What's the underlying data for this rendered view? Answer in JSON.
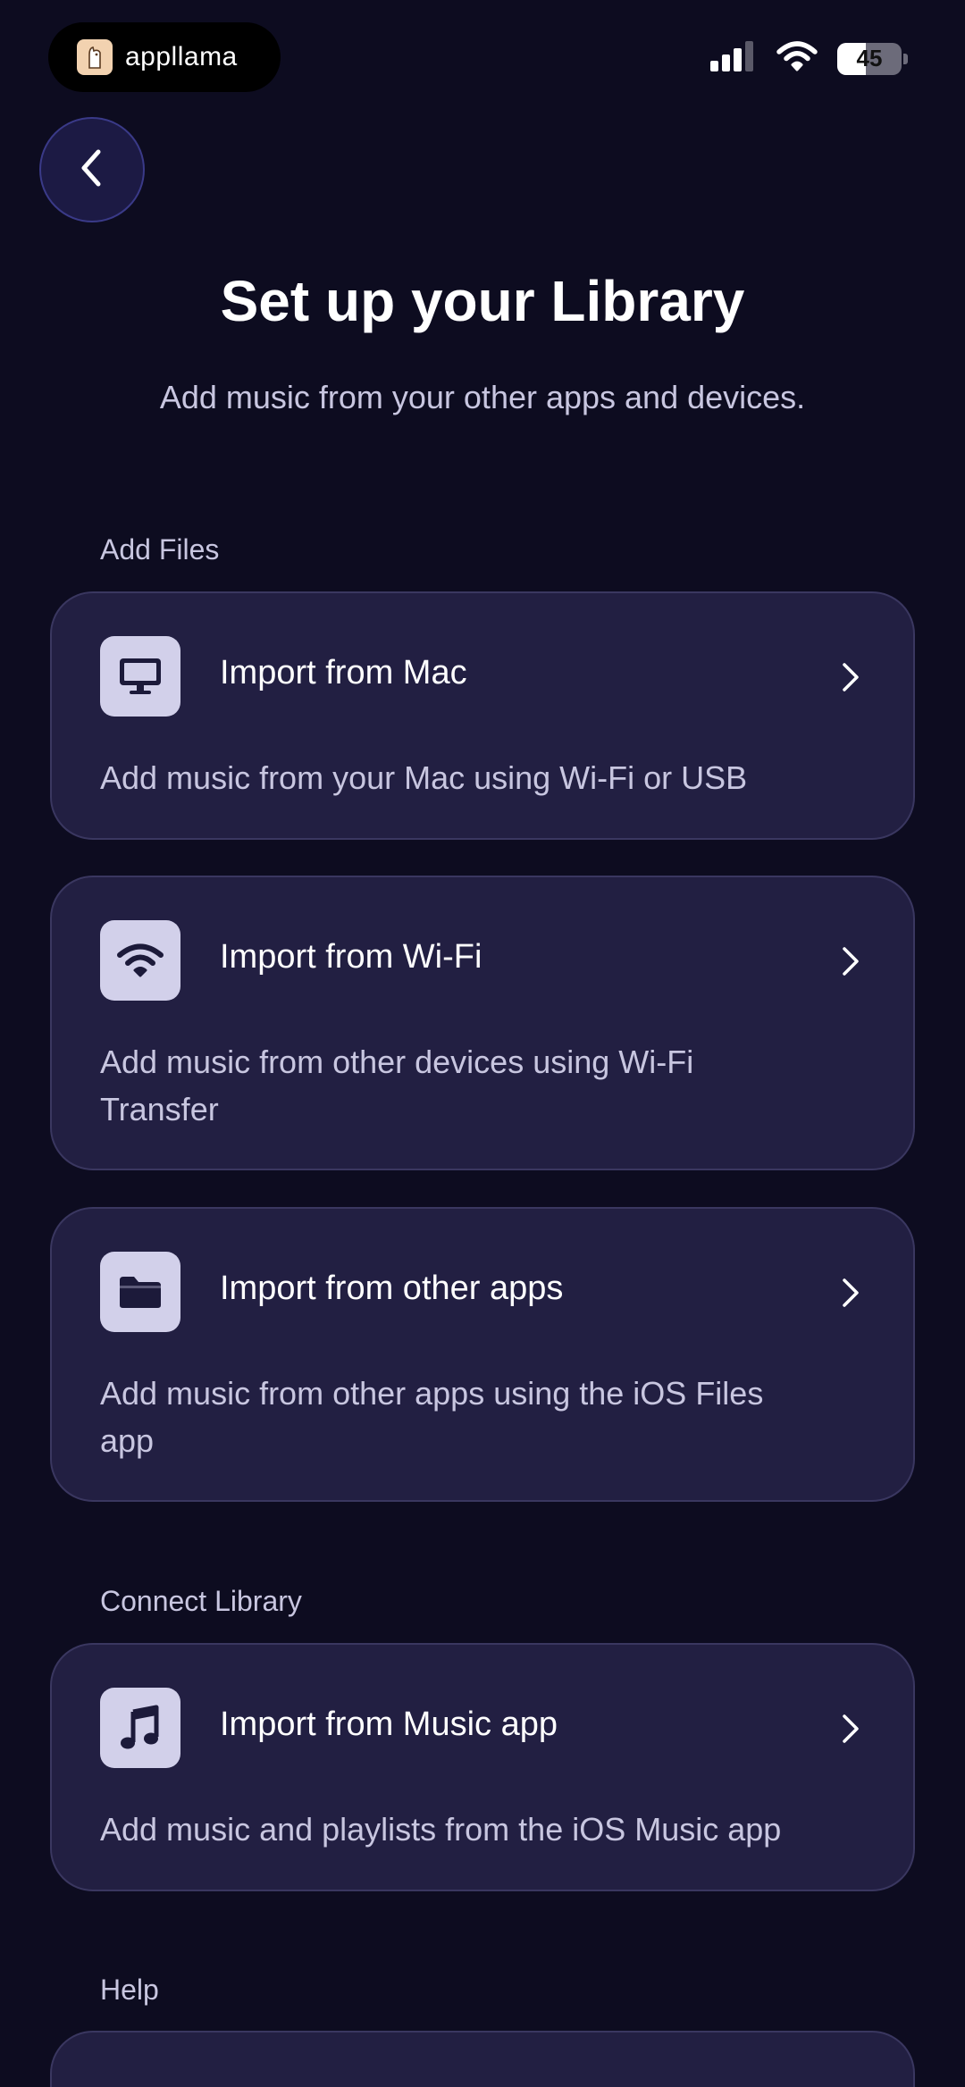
{
  "status_bar": {
    "app_name": "appllama",
    "battery_level": "45",
    "battery_fraction": 0.45
  },
  "page": {
    "title": "Set up your Library",
    "subtitle": "Add music from your other apps and devices."
  },
  "sections": {
    "add_files_label": "Add Files",
    "connect_library_label": "Connect Library",
    "help_label": "Help"
  },
  "cards": {
    "mac": {
      "icon": "desktop-icon",
      "title": "Import from Mac",
      "description": "Add music from your Mac using Wi-Fi or USB"
    },
    "wifi": {
      "icon": "wifi-icon",
      "title": "Import from Wi-Fi",
      "description": "Add music from other devices using Wi-Fi Transfer"
    },
    "other_apps": {
      "icon": "folder-icon",
      "title": "Import from other apps",
      "description": "Add music from other apps using the iOS Files app"
    },
    "music_app": {
      "icon": "music-note-icon",
      "title": "Import from Music app",
      "description": "Add music and playlists from the iOS Music app"
    }
  },
  "colors": {
    "background": "#0d0c20",
    "card_background": "#221f42",
    "card_border": "#3a3760",
    "icon_tile": "#d2d0ea",
    "secondary_text": "#c8c6e0"
  }
}
